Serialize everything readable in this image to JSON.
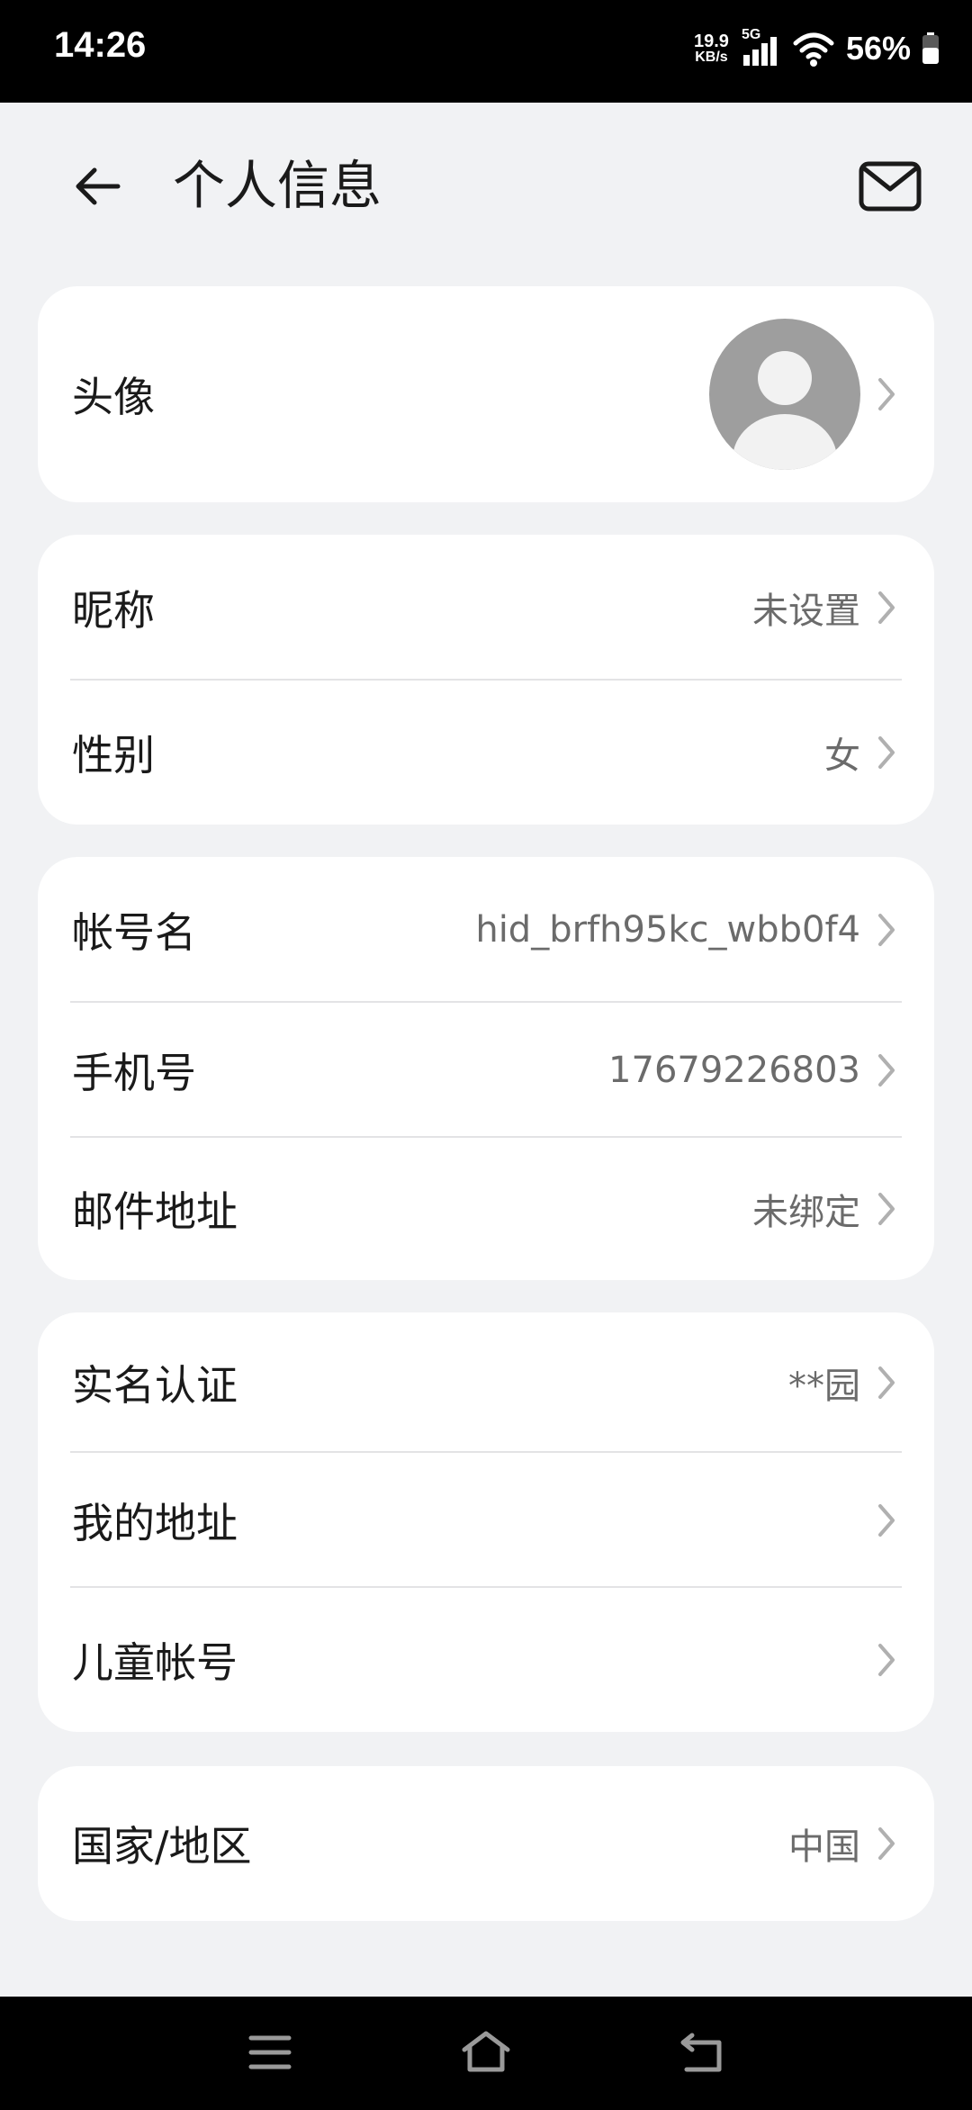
{
  "status_bar": {
    "time": "14:26",
    "net_speed_value": "19.9",
    "net_speed_unit": "KB/s",
    "network_type": "5G",
    "battery_percent": "56%",
    "battery_level": 0.56
  },
  "header": {
    "title": "个人信息"
  },
  "sections": {
    "avatar": {
      "label": "头像"
    },
    "nickname": {
      "label": "昵称",
      "value": "未设置"
    },
    "gender": {
      "label": "性别",
      "value": "女"
    },
    "account_name": {
      "label": "帐号名",
      "value": "hid_brfh95kc_wbb0f4"
    },
    "phone": {
      "label": "手机号",
      "value": "17679226803"
    },
    "email": {
      "label": "邮件地址",
      "value": "未绑定"
    },
    "real_name": {
      "label": "实名认证",
      "value": "**园"
    },
    "my_address": {
      "label": "我的地址",
      "value": ""
    },
    "child_account": {
      "label": "儿童帐号",
      "value": ""
    },
    "region": {
      "label": "国家/地区",
      "value": "中国"
    }
  },
  "colors": {
    "background": "#f1f2f4",
    "card": "#ffffff",
    "text_primary": "#1a1a1a",
    "text_secondary": "#6b6b6b",
    "chevron": "#b0b0b0",
    "avatar_bg": "#9e9e9e"
  },
  "icons": {
    "back": "arrow-left-icon",
    "mail": "envelope-icon",
    "chevron": "chevron-right-icon",
    "avatar": "default-user-icon",
    "nav_menu": "menu-icon",
    "nav_home": "home-icon",
    "nav_back": "return-icon"
  }
}
